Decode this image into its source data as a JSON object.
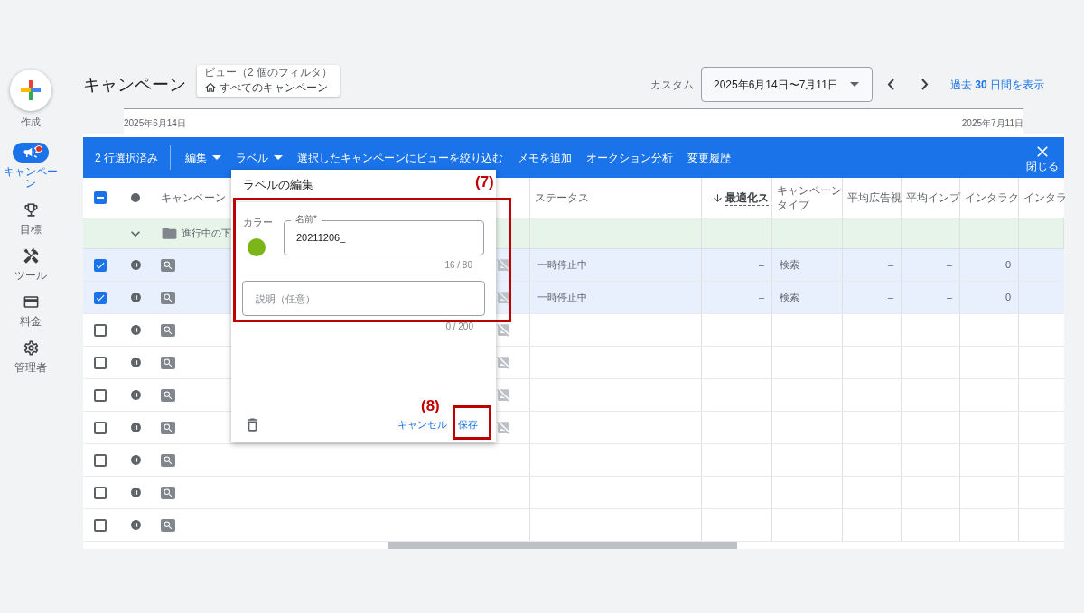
{
  "sidebar": {
    "create_label": "作成",
    "items": [
      {
        "kind": "megaphone",
        "label": "キャンペーン",
        "selected": true,
        "badge": true
      },
      {
        "kind": "trophy",
        "label": "目標",
        "selected": false,
        "badge": false
      },
      {
        "kind": "tools",
        "label": "ツール",
        "selected": false,
        "badge": false
      },
      {
        "kind": "card",
        "label": "料金",
        "selected": false,
        "badge": false
      },
      {
        "kind": "gear",
        "label": "管理者",
        "selected": false,
        "badge": false
      }
    ]
  },
  "header": {
    "title": "キャンペーン",
    "view_caption": "ビュー（2 個のフィルタ）",
    "view_name": "すべてのキャンペーン",
    "range_label": "カスタム",
    "date_range": "2025年6月14日〜7月11日",
    "recent_link": "過去 **30** 日間を表示"
  },
  "timeline": {
    "start": "2025年6月14日",
    "end": "2025年7月11日"
  },
  "action_bar": {
    "selection": "2 行選択済み",
    "actions": [
      {
        "label": "編集",
        "dropdown": true
      },
      {
        "label": "ラベル",
        "dropdown": true
      },
      {
        "label": "選択したキャンペーンにビューを絞り込む",
        "dropdown": false
      },
      {
        "label": "メモを追加",
        "dropdown": false
      },
      {
        "label": "オークション分析",
        "dropdown": false
      },
      {
        "label": "変更履歴",
        "dropdown": false
      }
    ],
    "close": "閉じる"
  },
  "table": {
    "select_all": {
      "indeterminate": true
    },
    "columns": [
      {
        "kind": "campaign",
        "label": "キャンペーン",
        "sorted": false
      },
      {
        "kind": "status",
        "label": "ステータス",
        "sorted": false
      },
      {
        "kind": "optimization",
        "label": "最適化ス",
        "sorted": true
      },
      {
        "kind": "type",
        "label": "キャンペーンタイプ",
        "sorted": false
      },
      {
        "kind": "avg_view",
        "label": "平均広告視",
        "sorted": false
      },
      {
        "kind": "avg_imp",
        "label": "平均インプ",
        "sorted": false
      },
      {
        "kind": "interactions",
        "label": "インタラク",
        "sorted": false
      },
      {
        "kind": "interactions_2",
        "label": "インタラ",
        "sorted": false
      }
    ],
    "group_row": {
      "label": "進行中の下",
      "expanded": true
    },
    "rows": [
      {
        "checked": true,
        "image_missing": true,
        "status": "一時停止中",
        "optimization": "–",
        "type": "検索",
        "avg_view": "–",
        "avg_imp": "–",
        "interactions": "0"
      },
      {
        "checked": true,
        "image_missing": true,
        "status": "一時停止中",
        "optimization": "–",
        "type": "検索",
        "avg_view": "–",
        "avg_imp": "–",
        "interactions": "0"
      },
      {
        "checked": false,
        "image_missing": true
      },
      {
        "checked": false,
        "image_missing": true
      },
      {
        "checked": false,
        "image_missing": true
      },
      {
        "checked": false,
        "image_missing": true
      },
      {
        "checked": false
      },
      {
        "checked": false
      },
      {
        "checked": false
      }
    ]
  },
  "dialog": {
    "title": "ラベルの編集",
    "color_label": "カラー",
    "color": "#7cb518",
    "name_label": "名前*",
    "name_value": "20211206_",
    "name_count": "16 / 80",
    "description_placeholder": "説明（任意）",
    "description_count": "0 / 200",
    "cancel": "キャンセル",
    "save": "保存"
  },
  "annotations": [
    {
      "label": "(7)"
    },
    {
      "label": "(8)"
    }
  ]
}
